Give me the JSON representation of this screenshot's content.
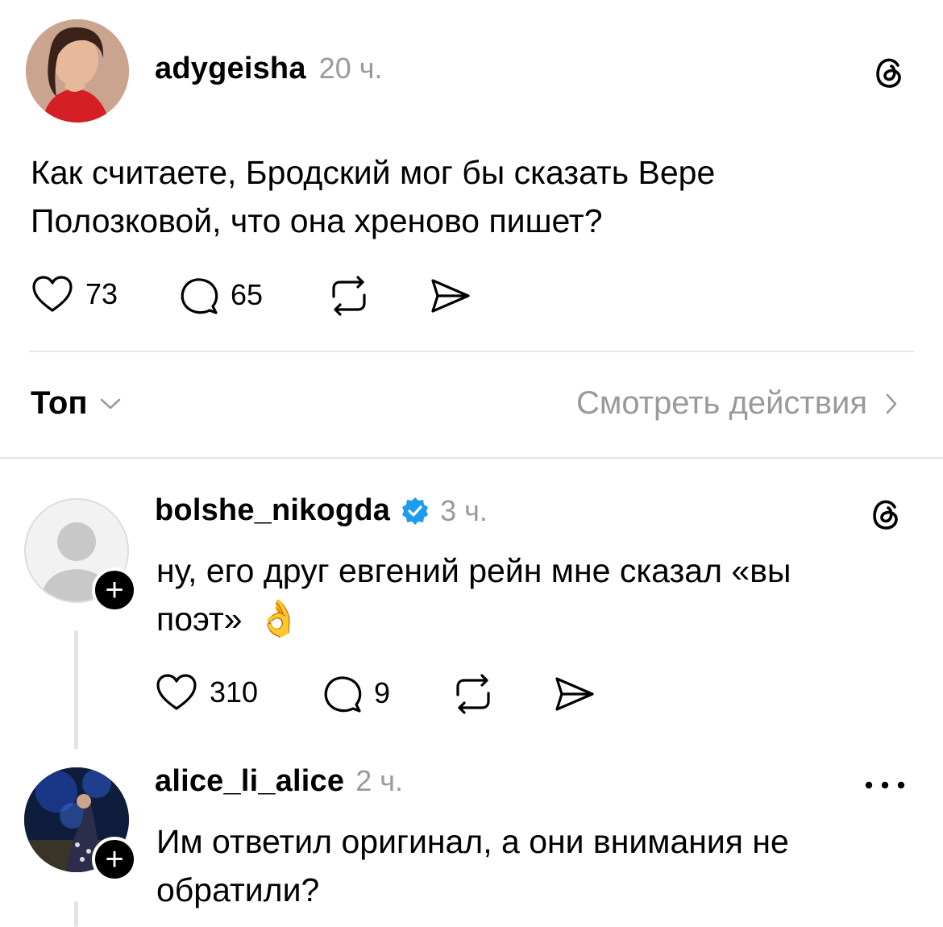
{
  "post": {
    "username": "adygeisha",
    "time": "20 ч.",
    "text_line1": "Как считаете, Бродский мог бы сказать Вере",
    "text_line2": "Полозковой, что она хреново пишет?",
    "likes": "73",
    "comments": "65"
  },
  "sort_bar": {
    "sort_label": "Топ",
    "activity_label": "Смотреть действия"
  },
  "replies": [
    {
      "username": "bolshe_nikogda",
      "verified": true,
      "time": "3 ч.",
      "text_line1": "ну, его друг евгений рейн мне сказал «вы",
      "text_line2": "поэт»",
      "emoji": "👌",
      "likes": "310",
      "comments": "9"
    },
    {
      "username": "alice_li_alice",
      "time": "2 ч.",
      "text_line1": "Им ответил оригинал, а они внимания не",
      "text_line2": "обратили?"
    }
  ],
  "icons": {
    "like": "heart-icon",
    "comment": "comment-bubble-icon",
    "repost": "repost-icon",
    "share": "share-send-icon",
    "threads": "threads-logo-icon",
    "more": "more-dots-icon",
    "verified": "verified-badge-icon",
    "follow": "plus-icon"
  },
  "colors": {
    "text": "#000000",
    "muted": "#9a9a9a",
    "verified": "#1d9bf0",
    "divider": "#e6e6e6"
  }
}
